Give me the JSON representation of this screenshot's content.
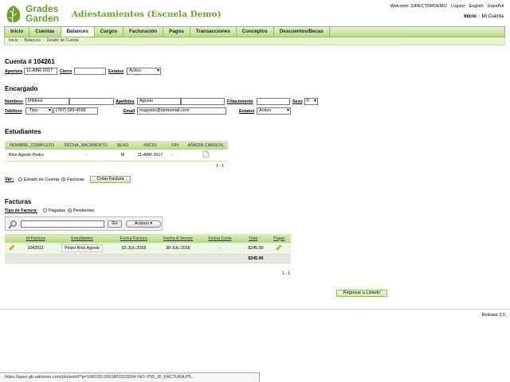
{
  "header": {
    "logo_line1": "Grades",
    "logo_line2": "Garden",
    "app_title": "Adiestamientos (Escuela Demo)",
    "welcome": "Welcome: DIRECTORDEMO",
    "logout": "Logout",
    "lang_en": "English",
    "lang_es": "Español",
    "inicio": "Inicio",
    "sep": "|",
    "mi_cuenta": "Mi Cuenta"
  },
  "tabs": [
    {
      "label": "Inicio"
    },
    {
      "label": "Cuentas"
    },
    {
      "label": "Balances"
    },
    {
      "label": "Cargos"
    },
    {
      "label": "Facturación"
    },
    {
      "label": "Pagos"
    },
    {
      "label": "Transacciones"
    },
    {
      "label": "Conceptos"
    },
    {
      "label": "Descuentos/Becas"
    }
  ],
  "active_tab": "Balances",
  "breadcrumb": [
    "Inicio",
    "Balances",
    "Detalle de Cuenta"
  ],
  "cuenta": {
    "title": "Cuenta # 104261",
    "apertura_label": "Apertura",
    "apertura_value": "11-ABR-2017",
    "cierre_label": "Cierre",
    "cierre_value": "",
    "estatus_label": "Estatus",
    "estatus_value": "Activo"
  },
  "encargado": {
    "title": "Encargado",
    "nombres_label": "Nombres",
    "nombres_value": "Mildred",
    "apellidos_label": "Apellidos",
    "apellidos_value": "Agosto",
    "nacimiento_label": "F.Nacimiento",
    "sexo_label": "Sexo",
    "sexo_value": "F",
    "telefono_label": "Teléfono",
    "telefono_tipo": "-Tipo-",
    "telefono_value": "(787) 589-4598",
    "email_label": "Email",
    "email_value": "magosto@demomail.com",
    "estatus_label": "Estatus",
    "estatus_value": "Activo"
  },
  "estudiantes": {
    "title": "Estudiantes",
    "headers": [
      "NOMBRE_COMPLETO",
      "FECHA_NACIMIENTO",
      "SEXO",
      "INICIO",
      "FIN",
      "AÑADIR CARGOS"
    ],
    "rows": [
      [
        "Rios Agosto Pedro",
        "-",
        "M",
        "11-ABR-2017",
        "-",
        ""
      ]
    ],
    "pager": "1 - 1"
  },
  "ver": {
    "label": "Ver:",
    "opt1": "Estado de Cuenta",
    "opt2": "Facturas",
    "selected": "Facturas",
    "button": "Crear Factura"
  },
  "facturas": {
    "title": "Facturas",
    "tipo_label": "Tipo de Factura:",
    "opt1": "Pagadas",
    "opt2": "Pendientes",
    "selected": "Pendientes",
    "go": "Go",
    "actions": "Actions ▾",
    "headers": [
      "",
      "Id Factura",
      "Estudiantes",
      "Fecha Factura",
      "Fecha A Vencer",
      "Fecha Corte",
      "Total",
      "Pagar"
    ],
    "rows": [
      [
        "",
        "1042611",
        "Pedro Rios Agosto",
        "02-JUL-2018",
        "30-JUL-2018",
        "-",
        "$245.00",
        ""
      ]
    ],
    "total": "$245.00",
    "pager": "1 - 1",
    "back_button": "Regresar a Listado"
  },
  "footer": {
    "release": "Release 3.0",
    "status_url": "https://apex.gb-advisors.com/pls/web/f?p=1060:55:2051801523034::NO::P55_ID_FACTURA,P5..."
  },
  "colors": {
    "brand_green": "#6aa42f",
    "tab_border": "#94c15a"
  }
}
